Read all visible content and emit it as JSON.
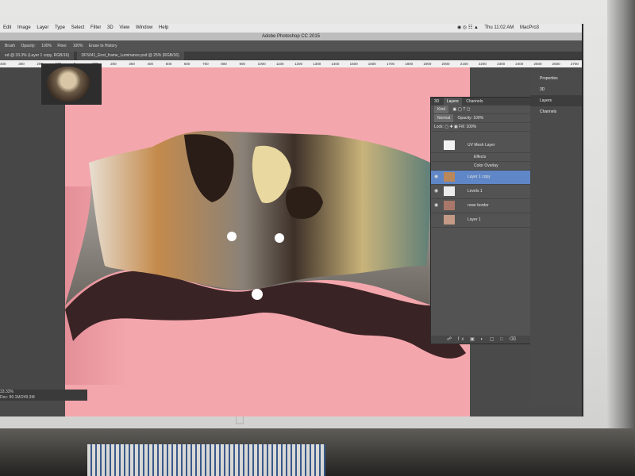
{
  "menubar": {
    "items": [
      "Edit",
      "Image",
      "Layer",
      "Type",
      "Select",
      "Filter",
      "3D",
      "View",
      "Window",
      "Help"
    ],
    "clock": "Thu 11:02 AM",
    "user": "MacPro3"
  },
  "window_title": "Adobe Photoshop CC 2015",
  "options_bar": {
    "tool": "Brush",
    "opacity_label": "Opacity:",
    "opacity_value": "100%",
    "flow_label": "Flow:",
    "flow_value": "100%",
    "erase_label": "Erase to History"
  },
  "tabs": [
    "ed @ 33.3% (Layer 1 copy, RGB/16)",
    "DF5041_Enst_frame_Luminance.psd @ 25% (RGB/16)"
  ],
  "ruler_ticks": [
    "400",
    "300",
    "200",
    "100",
    "0",
    "100",
    "200",
    "300",
    "400",
    "500",
    "600",
    "700",
    "800",
    "900",
    "1000",
    "1100",
    "1200",
    "1300",
    "1400",
    "1500",
    "1600",
    "1700",
    "1800",
    "1900",
    "2000",
    "2100",
    "2200",
    "2300",
    "2400",
    "2500",
    "2600",
    "2700",
    "2800",
    "2900",
    "3000",
    "3100",
    "3200",
    "3300",
    "3400",
    "3500",
    "3600",
    "3700",
    "3800",
    "3900",
    "4000",
    "4100",
    "4200"
  ],
  "status_bar": {
    "zoom": "33.33%",
    "doc": "Doc: 80.1M/249.3M",
    "timeline": "Timeline"
  },
  "panel": {
    "tabs": [
      "3D",
      "Layers",
      "Channels"
    ],
    "kind_label": "Kind",
    "blend_mode": "Normal",
    "opacity_label": "Opacity:",
    "opacity_value": "100%",
    "lock_label": "Lock:",
    "fill_label": "Fill:",
    "fill_value": "100%",
    "layers": [
      {
        "name": "UV Mesh Layer",
        "kind": "layer",
        "visible": false,
        "selected": false
      },
      {
        "name": "Effects",
        "kind": "sub",
        "visible": false,
        "selected": false
      },
      {
        "name": "Color Overlay",
        "kind": "sub",
        "visible": false,
        "selected": false
      },
      {
        "name": "Layer 1 copy",
        "kind": "layer",
        "visible": true,
        "selected": true
      },
      {
        "name": "Levels 1",
        "kind": "layer",
        "visible": true,
        "selected": false
      },
      {
        "name": "nose border",
        "kind": "layer",
        "visible": true,
        "selected": false
      },
      {
        "name": "Layer 1",
        "kind": "layer",
        "visible": false,
        "selected": false
      }
    ]
  },
  "dock": {
    "items": [
      "Properties",
      "3D",
      "Layers",
      "Channels"
    ]
  },
  "colors": {
    "canvas": "#f4a6ad",
    "selected_layer": "#5f86c6",
    "panel": "#535353"
  }
}
